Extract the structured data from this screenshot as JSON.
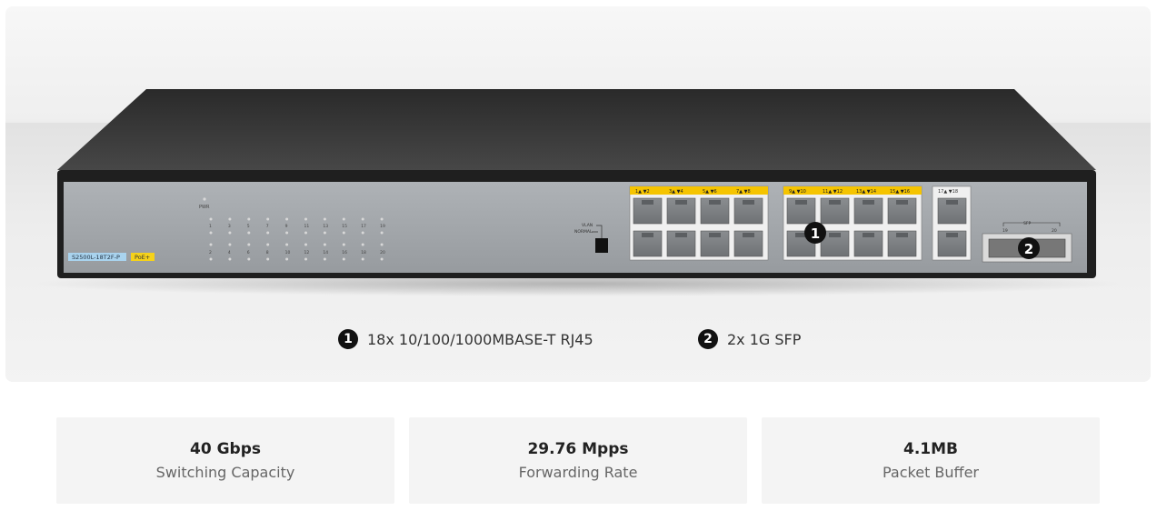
{
  "device": {
    "model_label": "S2500L-18T2F-P",
    "poe_label": "PoE+",
    "pwr_label": "PWR",
    "led_top_numbers": [
      "1",
      "3",
      "5",
      "7",
      "9",
      "11",
      "13",
      "15",
      "17",
      "19"
    ],
    "led_bottom_numbers": [
      "2",
      "4",
      "6",
      "8",
      "10",
      "12",
      "14",
      "16",
      "18",
      "20"
    ],
    "vlan_label": "VLAN",
    "normal_label": "NORMAL",
    "port_group_labels": [
      "1▲ ▼2",
      "3▲ ▼4",
      "5▲ ▼6",
      "7▲ ▼8",
      "9▲ ▼10",
      "11▲ ▼12",
      "13▲ ▼14",
      "15▲ ▼16"
    ],
    "port_group_3_label": "17▲ ▼18",
    "sfp_label": "SFP",
    "sfp_numbers": [
      "19",
      "20"
    ],
    "callout_1": "1",
    "callout_2": "2"
  },
  "legend": [
    {
      "badge": "1",
      "text": "18x 10/100/1000MBASE-T RJ45"
    },
    {
      "badge": "2",
      "text": "2x 1G SFP"
    }
  ],
  "specs": [
    {
      "value": "40 Gbps",
      "label": "Switching Capacity"
    },
    {
      "value": "29.76 Mpps",
      "label": "Forwarding Rate"
    },
    {
      "value": "4.1MB",
      "label": "Packet Buffer"
    }
  ],
  "colors": {
    "chassis_top": "#3a3a3a",
    "front_panel": "#9ea2a6",
    "port_label_bar": "#f5c400",
    "model_tag": "#a9d3ee",
    "poe_tag": "#f5d21a"
  }
}
